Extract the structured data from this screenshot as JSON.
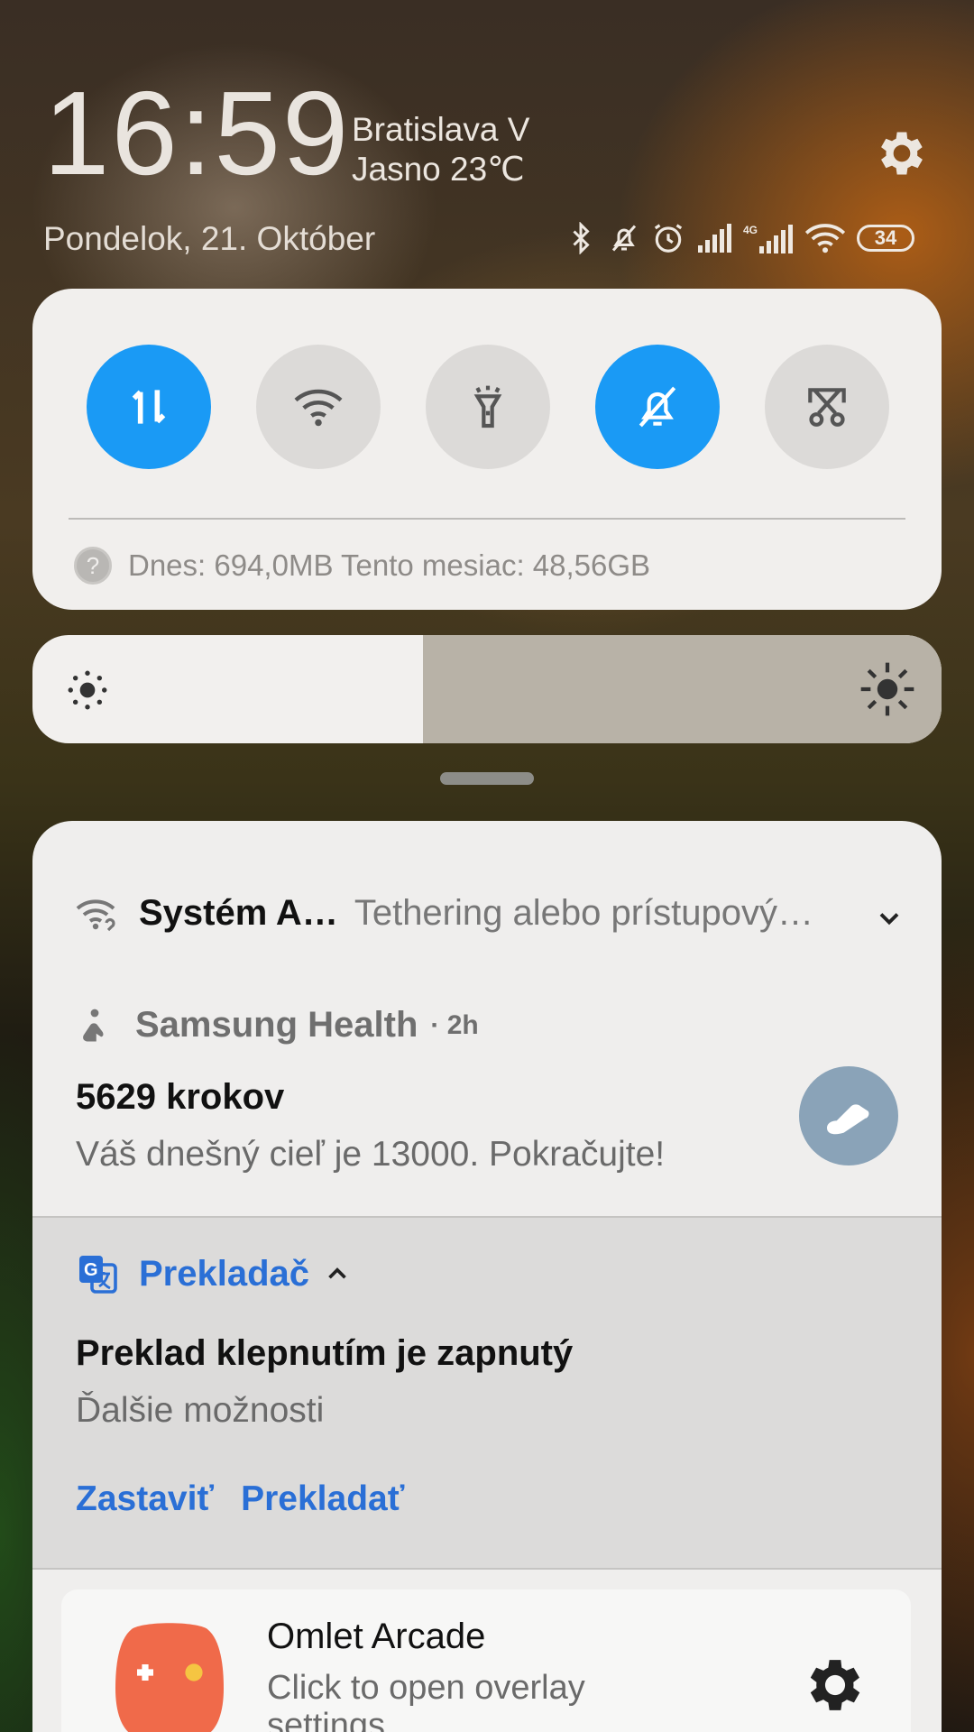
{
  "header": {
    "time": "16:59",
    "location": "Bratislava V",
    "weather": "Jasno 23℃",
    "date": "Pondelok, 21. Október",
    "battery_level": "34"
  },
  "status_icons": [
    "bluetooth-icon",
    "mute-icon",
    "alarm-icon",
    "signal-icon",
    "4g-signal-icon",
    "wifi-icon",
    "battery-icon"
  ],
  "quick_settings": {
    "toggles": [
      {
        "name": "mobile-data",
        "active": true
      },
      {
        "name": "wifi",
        "active": false
      },
      {
        "name": "flashlight",
        "active": false
      },
      {
        "name": "mute",
        "active": true
      },
      {
        "name": "screenshot",
        "active": false
      }
    ],
    "data_usage": "Dnes: 694,0MB Tento mesiac: 48,56GB"
  },
  "brightness": {
    "level": 0.43
  },
  "notifications": {
    "hotspot": {
      "app": "Systém A…",
      "text": "Tethering alebo prístupový…"
    },
    "health": {
      "app": "Samsung Health",
      "time": "· 2h",
      "title": "5629 krokov",
      "body": "Váš dnešný cieľ je 13000. Pokračujte!"
    },
    "translate": {
      "app": "Prekladač",
      "title": "Preklad klepnutím je zapnutý",
      "body": "Ďalšie možnosti",
      "actions": [
        "Zastaviť",
        "Prekladať"
      ]
    },
    "omlet": {
      "app": "Omlet Arcade",
      "body": "Click to open overlay settings"
    }
  },
  "colors": {
    "accent": "#1a9af5",
    "link": "#2a6fd6"
  }
}
